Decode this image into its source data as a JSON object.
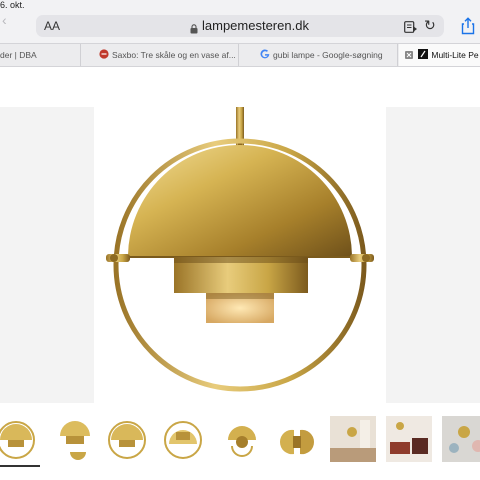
{
  "status_bar": {
    "time": "6. okt."
  },
  "toolbar": {
    "aa_label": "AA",
    "url": "lampemesteren.dk",
    "icons": [
      "back-icon",
      "lock-icon",
      "reader-icon",
      "reload-icon",
      "share-icon"
    ]
  },
  "tabs": [
    {
      "label": "der | DBA",
      "active": false
    },
    {
      "label": "Saxbo: Tre skåle og en vase af...",
      "active": false
    },
    {
      "label": "gubi lampe - Google-søgning",
      "active": false
    },
    {
      "label": "Multi-Lite Pe",
      "active": true
    }
  ],
  "gallery": {
    "main_image": "Multi-Lite brass pendant lamp",
    "thumbnail_count": 10,
    "active_thumbnail": 1
  },
  "colors": {
    "chrome_bg": "#f2f2f4",
    "urlbar_bg": "#e4e4e8",
    "accent_blue": "#1a73e8",
    "brass": "#c9a646"
  }
}
